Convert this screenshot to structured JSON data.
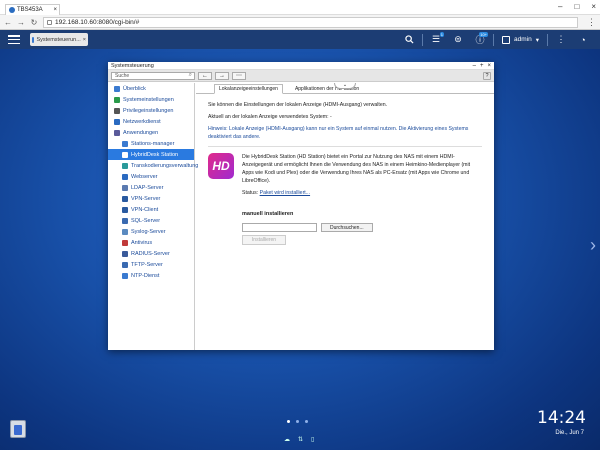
{
  "browser": {
    "tab_title": "TBS453A",
    "close": "×",
    "url": "192.168.10.60:8080/cgi-bin/#",
    "win_min": "–",
    "win_max": "□",
    "win_close": "×"
  },
  "taskbar": {
    "open_app": "Systemsteuerun...",
    "badge_notify": "1",
    "badge_events": "10+",
    "user": "admin"
  },
  "app": {
    "window_title": "Systemsteuerung",
    "search_placeholder": "Suche",
    "help": "?",
    "sidebar": [
      {
        "label": "Überblick",
        "color": "#3a7ad0",
        "sub": false,
        "active": false
      },
      {
        "label": "Systemeinstellungen",
        "color": "#2a9a4a",
        "sub": false,
        "active": false
      },
      {
        "label": "Privilegeinstellungen",
        "color": "#555555",
        "sub": false,
        "active": false
      },
      {
        "label": "Netzwerkdienst",
        "color": "#2a6ac0",
        "sub": false,
        "active": false
      },
      {
        "label": "Anwendungen",
        "color": "#5a5a9a",
        "sub": false,
        "active": false
      },
      {
        "label": "Stations-manager",
        "color": "#3a7ad0",
        "sub": true,
        "active": false
      },
      {
        "label": "HybridDesk Station",
        "color": "#e02a8a",
        "sub": true,
        "active": true
      },
      {
        "label": "Transkodierungsverwaltung",
        "color": "#2a9a9a",
        "sub": true,
        "active": false
      },
      {
        "label": "Webserver",
        "color": "#2a6ac0",
        "sub": true,
        "active": false
      },
      {
        "label": "LDAP-Server",
        "color": "#5a7ab0",
        "sub": true,
        "active": false
      },
      {
        "label": "VPN-Server",
        "color": "#2a5aa0",
        "sub": true,
        "active": false
      },
      {
        "label": "VPN-Client",
        "color": "#2a5aa0",
        "sub": true,
        "active": false
      },
      {
        "label": "SQL-Server",
        "color": "#3a6ab0",
        "sub": true,
        "active": false
      },
      {
        "label": "Syslog-Server",
        "color": "#5a8ac0",
        "sub": true,
        "active": false
      },
      {
        "label": "Antivirus",
        "color": "#c03a3a",
        "sub": true,
        "active": false
      },
      {
        "label": "RADIUS-Server",
        "color": "#3a5a9a",
        "sub": true,
        "active": false
      },
      {
        "label": "TFTP-Server",
        "color": "#3a6ab0",
        "sub": true,
        "active": false
      },
      {
        "label": "NTP-Dienst",
        "color": "#3a7ad0",
        "sub": true,
        "active": false
      }
    ],
    "tabs": [
      "Lokalanzeigeeinstellungen",
      "Applikationen der HD Station"
    ],
    "intro": "Sie können die Einstellungen der lokalen Anzeige (HDMI-Ausgang) verwalten.",
    "current": "Aktuell an der lokalen Anzeige verwendetes System: -",
    "hint": "Hinweis: Lokale Anzeige (HDMI-Ausgang) kann nur ein System auf einmal nutzen. Die Aktivierung eines Systems deaktiviert das andere.",
    "hd_logo": "HD",
    "hd_desc": "Die HybridDesk Station (HD Station) bietet ein Portal zur Nutzung des NAS mit einem HDMI-Anzeigegerät und ermöglicht Ihnen die Verwendung des NAS in einem Heimkino-Medienplayer (mit Apps wie Kodi und Plex) oder die Verwendung Ihres NAS als PC-Ersatz (mit Apps wie Chrome und LibreOffice).",
    "status_label": "Status:",
    "status_link": "Paket wird installiert...",
    "manual_title": "manuell installieren",
    "browse": "Durchsuchen...",
    "install": "Installieren"
  },
  "desktop": {
    "time": "14:24",
    "date": "Die., Jun 7"
  },
  "colors": {
    "accent": "#2a7ae0",
    "taskbar": "#1c3d74",
    "hd_logo": "#e02a8a"
  }
}
